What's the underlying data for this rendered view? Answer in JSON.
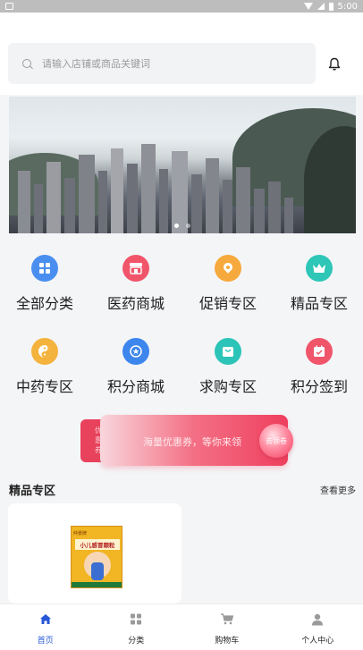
{
  "status_bar": {
    "time": "5:00"
  },
  "search": {
    "placeholder": "请输入店铺或商品关键词"
  },
  "banner": {
    "slide_count": 2,
    "active_index": 0
  },
  "categories": [
    {
      "label": "全部分类",
      "icon": "grid-icon",
      "color": "#4a8ff0"
    },
    {
      "label": "医药商城",
      "icon": "store-icon",
      "color": "#f0556a"
    },
    {
      "label": "促销专区",
      "icon": "promo-icon",
      "color": "#f6a93c"
    },
    {
      "label": "精品专区",
      "icon": "crown-icon",
      "color": "#2ec6b6"
    },
    {
      "label": "中药专区",
      "icon": "yinyang-icon",
      "color": "#f4b33d"
    },
    {
      "label": "积分商城",
      "icon": "points-icon",
      "color": "#3d86ee"
    },
    {
      "label": "求购专区",
      "icon": "bag-icon",
      "color": "#2cc4b8"
    },
    {
      "label": "积分签到",
      "icon": "calendar-icon",
      "color": "#f0556a"
    }
  ],
  "coupon": {
    "back_text": "优惠券",
    "text": "海量优惠券，等你来领",
    "button": "去领卷"
  },
  "section": {
    "title": "精品专区",
    "more": "查看更多"
  },
  "product": {
    "box_tag": "仲景牌",
    "box_name": "小儿感冒颗粒"
  },
  "tabs": [
    {
      "label": "首页",
      "icon": "home-icon",
      "active": true
    },
    {
      "label": "分类",
      "icon": "category-icon",
      "active": false
    },
    {
      "label": "购物车",
      "icon": "cart-icon",
      "active": false
    },
    {
      "label": "个人中心",
      "icon": "user-icon",
      "active": false
    }
  ],
  "colors": {
    "accent": "#2858d6",
    "coupon": "#ef3f5e"
  }
}
